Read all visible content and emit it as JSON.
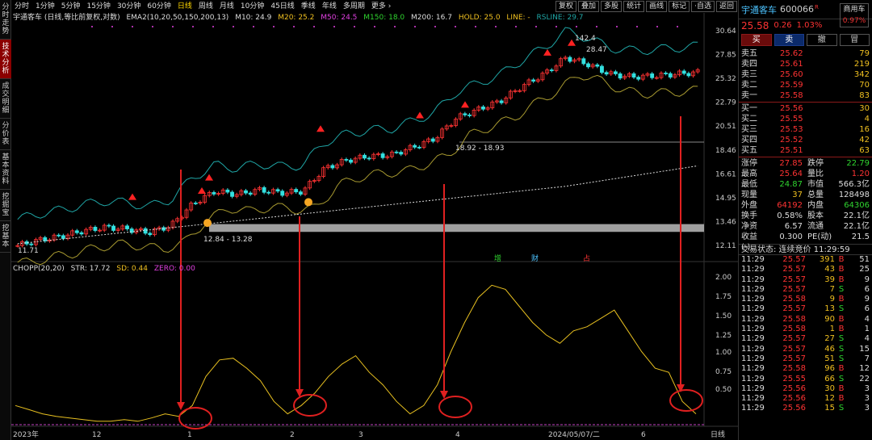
{
  "side_tabs": [
    {
      "label": "分时走势",
      "active": false
    },
    {
      "label": "技术分析",
      "active": true
    },
    {
      "label": "成交明细",
      "active": false
    },
    {
      "label": "分价表",
      "active": false
    },
    {
      "label": "基本资料",
      "active": false
    },
    {
      "label": "挖掘宝",
      "active": false
    },
    {
      "label": "挖基本",
      "active": false
    }
  ],
  "toolbar": {
    "periods": [
      "分时",
      "1分钟",
      "5分钟",
      "15分钟",
      "30分钟",
      "60分钟",
      "日线",
      "周线",
      "月线",
      "10分钟",
      "45日线",
      "季线",
      "年线",
      "多周期",
      "更多 ›"
    ],
    "active": "日线",
    "right_buttons": [
      "复权",
      "叠加",
      "多股",
      "统计",
      "画线",
      "标记",
      "·自选",
      "返回"
    ]
  },
  "main_legend": {
    "stock": "宇通客车 (日线,等比前复权,对数)",
    "ema_label": "EMA2(10,20,50,150,200,13)",
    "m10": "M10: 24.9",
    "m20": "M20: 25.2",
    "m50": "M50: 24.5",
    "m150": "M150: 18.0",
    "m200": "M200: 16.7",
    "hold": "HOLD: 25.0",
    "line": "LINE: -",
    "rsline": "RSLINE: 29.7"
  },
  "sub_legend": {
    "name": "CHOPP(20,20)",
    "str": "STR: 17.72",
    "sd": "SD: 0.44",
    "zero": "ZERO: 0.00"
  },
  "price_axis": [
    "30.64",
    "27.85",
    "25.32",
    "22.79",
    "20.51",
    "18.46",
    "16.61",
    "14.95",
    "13.46",
    "12.11"
  ],
  "sub_axis": [
    "2.00",
    "1.75",
    "1.50",
    "1.25",
    "1.00",
    "0.75",
    "0.50"
  ],
  "date_axis": {
    "labels": [
      "2023年",
      "12",
      "1",
      "2",
      "3",
      "4",
      "2024/05/07/二",
      "6"
    ],
    "right": "日线"
  },
  "annotations": {
    "box1": "12.84 - 13.28",
    "box2": "18.92 - 18.93",
    "high": "142.4",
    "high2": "28.47",
    "low": "11.71",
    "events": [
      "增",
      "财",
      "占"
    ]
  },
  "chart_data": {
    "type": "line",
    "title": "宇通客车 (日线,等比前复权,对数)",
    "ylim_main": [
      12.11,
      30.64
    ],
    "price_series": [
      {
        "name": "close",
        "values": [
          12.1,
          12.4,
          12.6,
          12.9,
          13.1,
          13.0,
          12.8,
          13.2,
          14.5,
          15.3,
          15.1,
          15.4,
          15.2,
          15.3,
          16.9,
          17.5,
          17.8,
          17.9,
          18.5,
          19.2,
          21.0,
          21.8,
          22.6,
          24.1,
          25.4,
          27.3,
          26.5,
          25.4,
          25.1,
          25.2,
          25.4,
          25.6
        ]
      }
    ],
    "indicator": {
      "name": "CHOPP(20,20)",
      "ylim": [
        0.3,
        2.1
      ],
      "values": [
        0.55,
        0.5,
        0.45,
        0.42,
        0.4,
        0.38,
        0.36,
        0.36,
        0.38,
        0.36,
        0.4,
        0.45,
        0.42,
        0.55,
        0.9,
        1.1,
        1.12,
        1.0,
        0.85,
        0.6,
        0.45,
        0.55,
        0.7,
        0.9,
        1.05,
        1.15,
        0.95,
        0.8,
        0.6,
        0.45,
        0.55,
        0.8,
        1.2,
        1.55,
        1.85,
        2.0,
        1.95,
        1.75,
        1.55,
        1.4,
        1.3,
        1.45,
        1.5,
        1.6,
        1.7,
        1.45,
        1.2,
        1.0,
        0.95,
        0.6,
        0.45
      ]
    }
  },
  "panel": {
    "name": "宇通客车",
    "code": "600066",
    "r": "R",
    "badge1": "商用车",
    "badge2": "0.97%",
    "price": "25.58",
    "change": "0.26",
    "pct": "1.03%",
    "buttons": [
      "买",
      "卖",
      "撤",
      "冒"
    ],
    "sell": [
      {
        "label": "卖五",
        "price": "25.62",
        "vol": "79"
      },
      {
        "label": "卖四",
        "price": "25.61",
        "vol": "219"
      },
      {
        "label": "卖三",
        "price": "25.60",
        "vol": "342"
      },
      {
        "label": "卖二",
        "price": "25.59",
        "vol": "70"
      },
      {
        "label": "卖一",
        "price": "25.58",
        "vol": "83"
      }
    ],
    "buy": [
      {
        "label": "买一",
        "price": "25.56",
        "vol": "30"
      },
      {
        "label": "买二",
        "price": "25.55",
        "vol": "4"
      },
      {
        "label": "买三",
        "price": "25.53",
        "vol": "16"
      },
      {
        "label": "买四",
        "price": "25.52",
        "vol": "42"
      },
      {
        "label": "买五",
        "price": "25.51",
        "vol": "63"
      }
    ],
    "quotes": [
      {
        "k": "涨停",
        "v": "27.85",
        "vc": "red",
        "k2": "跌停",
        "v2": "22.79",
        "v2c": "green"
      },
      {
        "k": "最高",
        "v": "25.64",
        "vc": "red",
        "k2": "量比",
        "v2": "1.20",
        "v2c": "red"
      },
      {
        "k": "最低",
        "v": "24.87",
        "vc": "green",
        "k2": "市值",
        "v2": "566.3亿",
        "v2c": "white"
      },
      {
        "k": "现量",
        "v": "37",
        "vc": "yellow",
        "k2": "总量",
        "v2": "128498",
        "v2c": "white"
      },
      {
        "k": "外盘",
        "v": "64192",
        "vc": "red",
        "k2": "内盘",
        "v2": "64306",
        "v2c": "green"
      },
      {
        "k": "换手",
        "v": "0.58%",
        "vc": "white",
        "k2": "股本",
        "v2": "22.1亿",
        "v2c": "white"
      },
      {
        "k": "净资",
        "v": "6.57",
        "vc": "white",
        "k2": "流通",
        "v2": "22.1亿",
        "v2c": "white"
      },
      {
        "k": "收益(-)",
        "v": "0.300",
        "vc": "white",
        "k2": "PE(动)",
        "v2": "21.5",
        "v2c": "white"
      }
    ],
    "status": "交易状态: 连续竞价 11:29:59",
    "ticks": [
      {
        "t": "11:29",
        "p": "25.57",
        "v": "391",
        "s": "B",
        "n": "51"
      },
      {
        "t": "11:29",
        "p": "25.57",
        "v": "43",
        "s": "B",
        "n": "25"
      },
      {
        "t": "11:29",
        "p": "25.57",
        "v": "39",
        "s": "B",
        "n": "9"
      },
      {
        "t": "11:29",
        "p": "25.57",
        "v": "7",
        "s": "S",
        "n": "6"
      },
      {
        "t": "11:29",
        "p": "25.58",
        "v": "9",
        "s": "B",
        "n": "9"
      },
      {
        "t": "11:29",
        "p": "25.57",
        "v": "13",
        "s": "S",
        "n": "6"
      },
      {
        "t": "11:29",
        "p": "25.58",
        "v": "90",
        "s": "B",
        "n": "4"
      },
      {
        "t": "11:29",
        "p": "25.58",
        "v": "1",
        "s": "B",
        "n": "1"
      },
      {
        "t": "11:29",
        "p": "25.57",
        "v": "27",
        "s": "S",
        "n": "4"
      },
      {
        "t": "11:29",
        "p": "25.57",
        "v": "46",
        "s": "S",
        "n": "15"
      },
      {
        "t": "11:29",
        "p": "25.57",
        "v": "51",
        "s": "S",
        "n": "7"
      },
      {
        "t": "11:29",
        "p": "25.58",
        "v": "96",
        "s": "B",
        "n": "12"
      },
      {
        "t": "11:29",
        "p": "25.55",
        "v": "66",
        "s": "S",
        "n": "22"
      },
      {
        "t": "11:29",
        "p": "25.56",
        "v": "30",
        "s": "B",
        "n": "3"
      },
      {
        "t": "11:29",
        "p": "25.56",
        "v": "12",
        "s": "B",
        "n": "3"
      },
      {
        "t": "11:29",
        "p": "25.56",
        "v": "15",
        "s": "S",
        "n": "3"
      }
    ]
  },
  "colors": {
    "red": "#ff3333",
    "green": "#2fd42f",
    "yellow": "#f0c020",
    "blue": "#4cc3ff",
    "cyan": "#1fa6a6"
  }
}
